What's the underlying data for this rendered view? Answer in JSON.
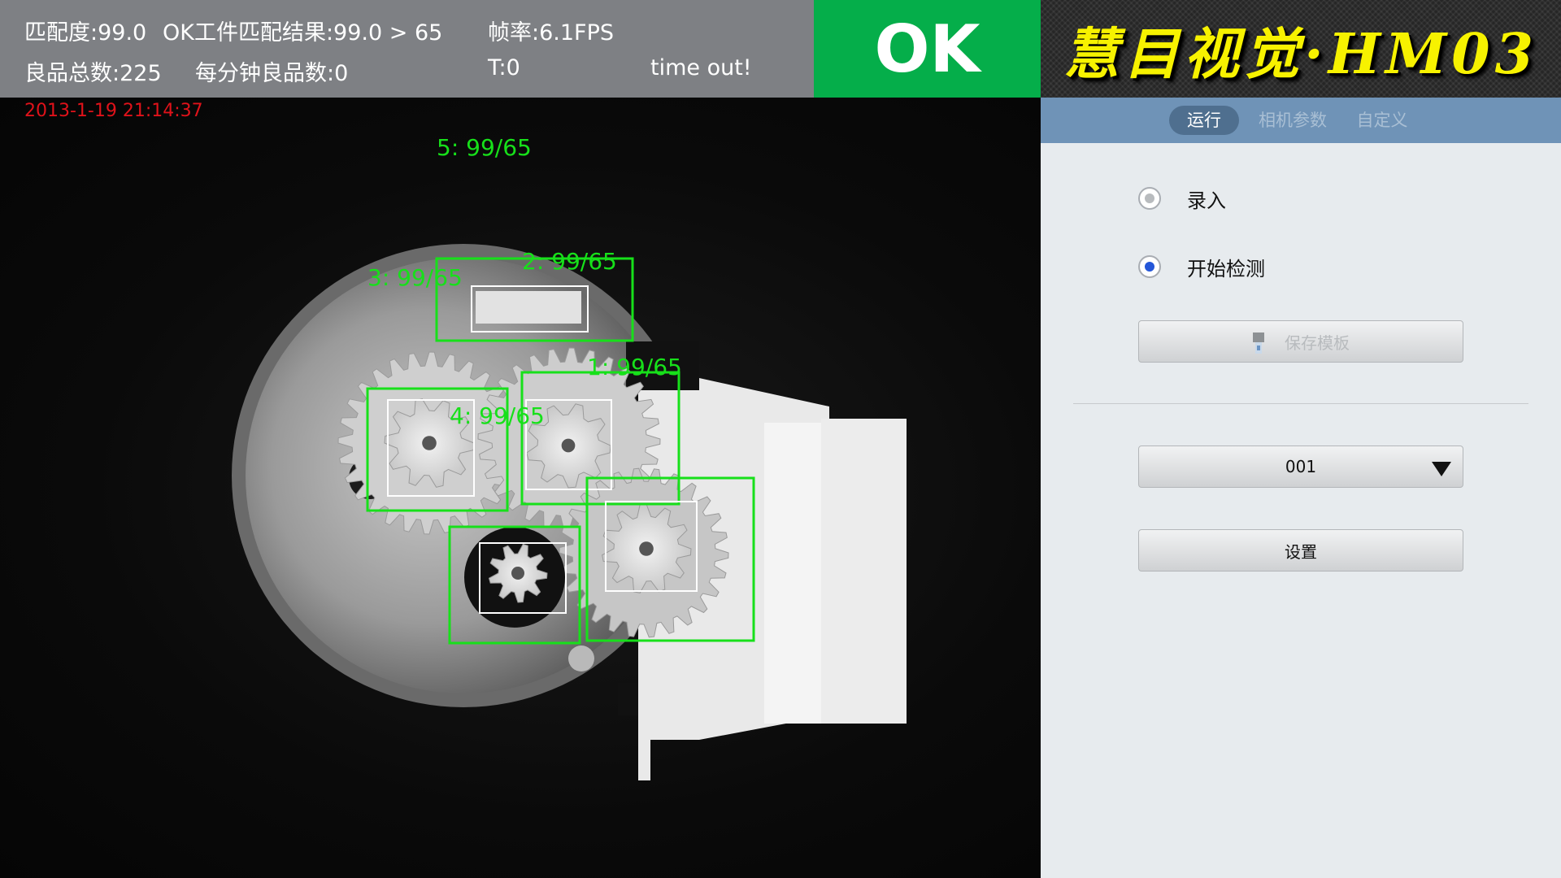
{
  "status_bar": {
    "match_degree": "匹配度:99.0",
    "match_result": "OK工件匹配结果:99.0 > 65",
    "frame_rate": "帧率:6.1FPS",
    "good_total": "良品总数:225",
    "good_per_minute": "每分钟良品数:0",
    "t_value": "T:0",
    "timeout": "time out!"
  },
  "result": {
    "text": "OK",
    "color": "#05ae4a"
  },
  "brand": {
    "title": "慧目视觉·HM03",
    "color": "#f7f200"
  },
  "camera_view": {
    "timestamp": "2013-1-19 21:14:37",
    "detections": [
      {
        "label": "5: 99/65"
      },
      {
        "label": "2: 99/65"
      },
      {
        "label": "3: 99/65"
      },
      {
        "label": "1: 99/65"
      },
      {
        "label": "4: 99/65"
      }
    ],
    "box_color": "#17e01a"
  },
  "tabs": [
    {
      "label": "运行",
      "active": true
    },
    {
      "label": "相机参数",
      "active": false
    },
    {
      "label": "自定义",
      "active": false
    }
  ],
  "options": [
    {
      "label": "录入",
      "selected": false
    },
    {
      "label": "开始检测",
      "selected": true
    }
  ],
  "save_template_button": {
    "label": "保存模板",
    "icon": "usb-drive-icon",
    "enabled": false
  },
  "template_select": {
    "value": "001"
  },
  "settings_button": {
    "label": "设置"
  },
  "accent_color": "#2456d8"
}
